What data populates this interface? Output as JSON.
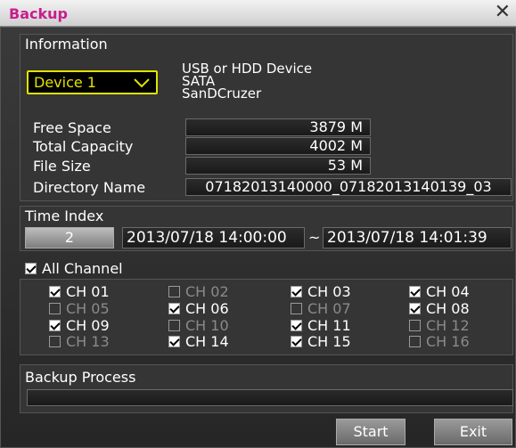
{
  "window": {
    "title": "Backup",
    "close_glyph": "✕"
  },
  "information": {
    "heading": "Information",
    "device_select": "Device 1",
    "device_lines": [
      "USB or HDD Device",
      "SATA",
      "SanDCruzer"
    ],
    "rows": [
      {
        "label": "Free Space",
        "value": "3879 M"
      },
      {
        "label": "Total Capacity",
        "value": "4002 M"
      },
      {
        "label": "File Size",
        "value": "53 M"
      },
      {
        "label": "Directory Name",
        "value": "07182013140000_07182013140139_03"
      }
    ]
  },
  "time_index": {
    "heading": "Time Index",
    "index_button": "2",
    "start_time": "2013/07/18  14:00:00",
    "separator": "~",
    "end_time": "2013/07/18  14:01:39"
  },
  "channels": {
    "all_label": "All Channel",
    "all_checked": true,
    "items": [
      {
        "label": "CH 01",
        "checked": true
      },
      {
        "label": "CH 02",
        "checked": false
      },
      {
        "label": "CH 03",
        "checked": true
      },
      {
        "label": "CH 04",
        "checked": true
      },
      {
        "label": "CH 05",
        "checked": false
      },
      {
        "label": "CH 06",
        "checked": true
      },
      {
        "label": "CH 07",
        "checked": false
      },
      {
        "label": "CH 08",
        "checked": true
      },
      {
        "label": "CH 09",
        "checked": true
      },
      {
        "label": "CH 10",
        "checked": false
      },
      {
        "label": "CH 11",
        "checked": true
      },
      {
        "label": "CH 12",
        "checked": false
      },
      {
        "label": "CH 13",
        "checked": false
      },
      {
        "label": "CH 14",
        "checked": true
      },
      {
        "label": "CH 15",
        "checked": true
      },
      {
        "label": "CH 16",
        "checked": false
      }
    ]
  },
  "backup_process": {
    "heading": "Backup Process",
    "progress": 0
  },
  "footer": {
    "start_label": "Start",
    "exit_label": "Exit"
  },
  "colors": {
    "accent_title": "#c81e8c",
    "device_select": "#e2e200",
    "dim_text": "#8a8a8a"
  }
}
